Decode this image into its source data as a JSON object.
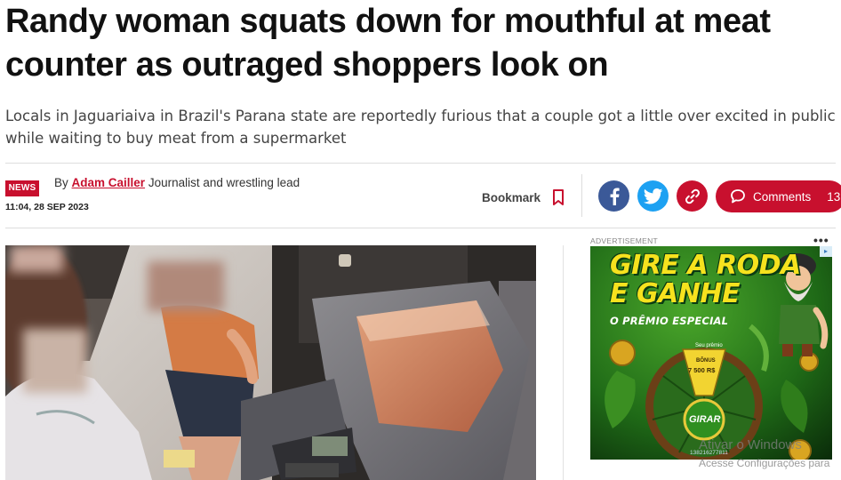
{
  "article": {
    "headline": "Randy woman squats down for mouthful at meat counter as outraged shoppers look on",
    "standfirst_line1": "Locals in Jaguariaiva in Brazil's Parana state are reportedly furious that a couple got a little over excited in public",
    "standfirst_line2": "while waiting to buy meat from a supermarket",
    "badge": "NEWS",
    "byline_prefix": "By",
    "author": "Adam Cailler",
    "author_role": "Journalist and wrestling lead",
    "timestamp": "11:04, 28 SEP 2023"
  },
  "actions": {
    "bookmark_label": "Bookmark",
    "comments_label": "Comments",
    "comments_count": "13"
  },
  "social": {
    "facebook_icon": "facebook-icon",
    "twitter_icon": "twitter-icon",
    "link_icon": "link-icon",
    "facebook_color": "#3b5998",
    "twitter_color": "#1da1f2",
    "link_color": "#c8102e"
  },
  "ad": {
    "label": "ADVERTISEMENT",
    "dots": "•••",
    "title_line1": "GIRE A RODA",
    "title_line2": "E GANHE",
    "subtitle": "O PRÊMIO ESPECIAL",
    "wheel_prize_label": "Seu prêmio",
    "wheel_bonus": "BÔNUS",
    "wheel_amount": "7 500 R$",
    "wheel_button": "GIRAR",
    "ad_id": "138216277811"
  },
  "os_watermark": {
    "line1": "Ativar o Windows",
    "line2": "Acesse Configurações para"
  },
  "colors": {
    "brand_red": "#c8102e",
    "ad_yellow": "#f6e21e"
  }
}
